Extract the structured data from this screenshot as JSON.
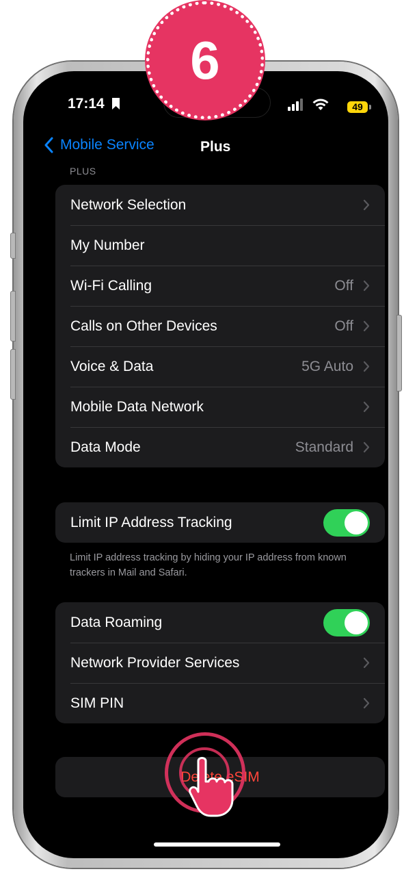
{
  "step": {
    "number": "6"
  },
  "status_bar": {
    "time": "17:14",
    "battery": "49",
    "icons": [
      "bookmark-icon",
      "cellular-signal-icon",
      "wifi-icon",
      "battery-icon"
    ]
  },
  "nav": {
    "back_label": "Mobile Service",
    "title": "Plus"
  },
  "section_header": "PLUS",
  "plan_group": [
    {
      "label": "Network Selection",
      "value": ""
    },
    {
      "label": "My Number",
      "value": ""
    },
    {
      "label": "Wi-Fi Calling",
      "value": "Off"
    },
    {
      "label": "Calls on Other Devices",
      "value": "Off"
    },
    {
      "label": "Voice & Data",
      "value": "5G Auto"
    },
    {
      "label": "Mobile Data Network",
      "value": ""
    },
    {
      "label": "Data Mode",
      "value": "Standard"
    }
  ],
  "ip_tracking": {
    "label": "Limit IP Address Tracking",
    "enabled": true,
    "footer": "Limit IP address tracking by hiding your IP address from known trackers in Mail and Safari."
  },
  "roaming_group": [
    {
      "label": "Data Roaming",
      "toggle": true,
      "enabled": true
    },
    {
      "label": "Network Provider Services"
    },
    {
      "label": "SIM PIN"
    }
  ],
  "delete_button": {
    "label": "Delete eSIM"
  },
  "colors": {
    "accent": "#0a84ff",
    "toggle_on": "#30d158",
    "destructive": "#ff453a",
    "annotation": "#e63462",
    "battery": "#ffd60a"
  }
}
